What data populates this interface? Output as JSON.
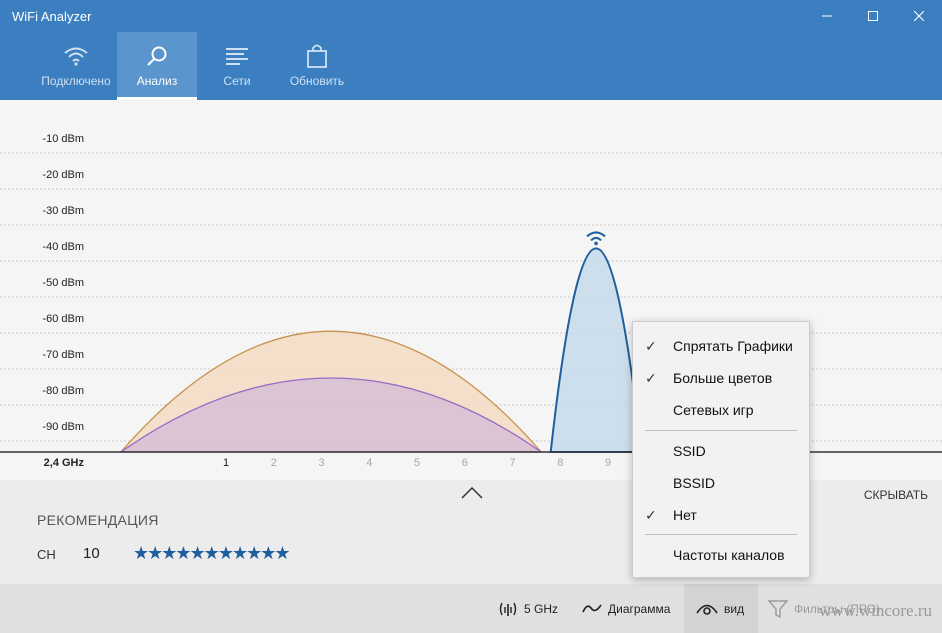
{
  "window": {
    "title": "WiFi Analyzer"
  },
  "nav": {
    "tabs": [
      {
        "label": "Подключено",
        "icon": "wifi-icon",
        "active": false
      },
      {
        "label": "Анализ",
        "icon": "magnifier-icon",
        "active": true
      },
      {
        "label": "Сети",
        "icon": "list-icon",
        "active": false
      },
      {
        "label": "Обновить",
        "icon": "bag-icon",
        "active": false
      }
    ]
  },
  "chart_data": {
    "type": "area",
    "ylabel_ticks": [
      "-10 dBm",
      "-20 dBm",
      "-30 dBm",
      "-40 dBm",
      "-50 dBm",
      "-60 dBm",
      "-70 dBm",
      "-80 dBm",
      "-90 dBm"
    ],
    "y_values": [
      -10,
      -20,
      -30,
      -40,
      -50,
      -60,
      -70,
      -80,
      -90
    ],
    "ylim": [
      -100,
      -7
    ],
    "band_label": "2,4 GHz",
    "x_ticks": [
      "1",
      "2",
      "3",
      "4",
      "5",
      "6",
      "7",
      "8",
      "9"
    ],
    "x_values": [
      1,
      2,
      3,
      4,
      5,
      6,
      7,
      8,
      9
    ],
    "active_tick": "1",
    "grid": true,
    "series": [
      {
        "center_channel": 3.2,
        "span": [
          -1.2,
          7.6
        ],
        "peak_dbm": -59.5,
        "color": "#c8914d",
        "fill": "#f3dcc2"
      },
      {
        "center_channel": 3.2,
        "span": [
          -1.2,
          7.6
        ],
        "peak_dbm": -72.5,
        "color": "#9a6bc7",
        "fill": "#d6bfd6"
      },
      {
        "center_channel": 8.75,
        "span": [
          7.8,
          9.7
        ],
        "peak_dbm": -36.5,
        "color": "#1f5f9e",
        "fill": "#c6d9ea"
      }
    ]
  },
  "recommendation": {
    "hide_label": "СКРЫВАТЬ",
    "heading": "РЕКОМЕНДАЦИЯ",
    "channel_label": "CH",
    "channel_value": "10",
    "stars": "★★★★★★★★★★★",
    "rating": 11
  },
  "toolbar": {
    "band_label": "5 GHz",
    "diagram_label": "Диаграмма",
    "view_label": "вид",
    "filters_label": "Фильтры (ПРО)",
    "more_label": "• • •",
    "watermark": "www.wincore.ru"
  },
  "menu": {
    "items": [
      {
        "label": "Спрятать Графики",
        "checked": true
      },
      {
        "label": "Больше цветов",
        "checked": true
      },
      {
        "label": "Сетевых игр",
        "checked": false
      },
      {
        "label": "SSID",
        "checked": false
      },
      {
        "label": "BSSID",
        "checked": false
      },
      {
        "label": "Нет",
        "checked": true
      },
      {
        "label": "Частоты каналов",
        "checked": false
      }
    ],
    "check_glyph": "✓"
  }
}
